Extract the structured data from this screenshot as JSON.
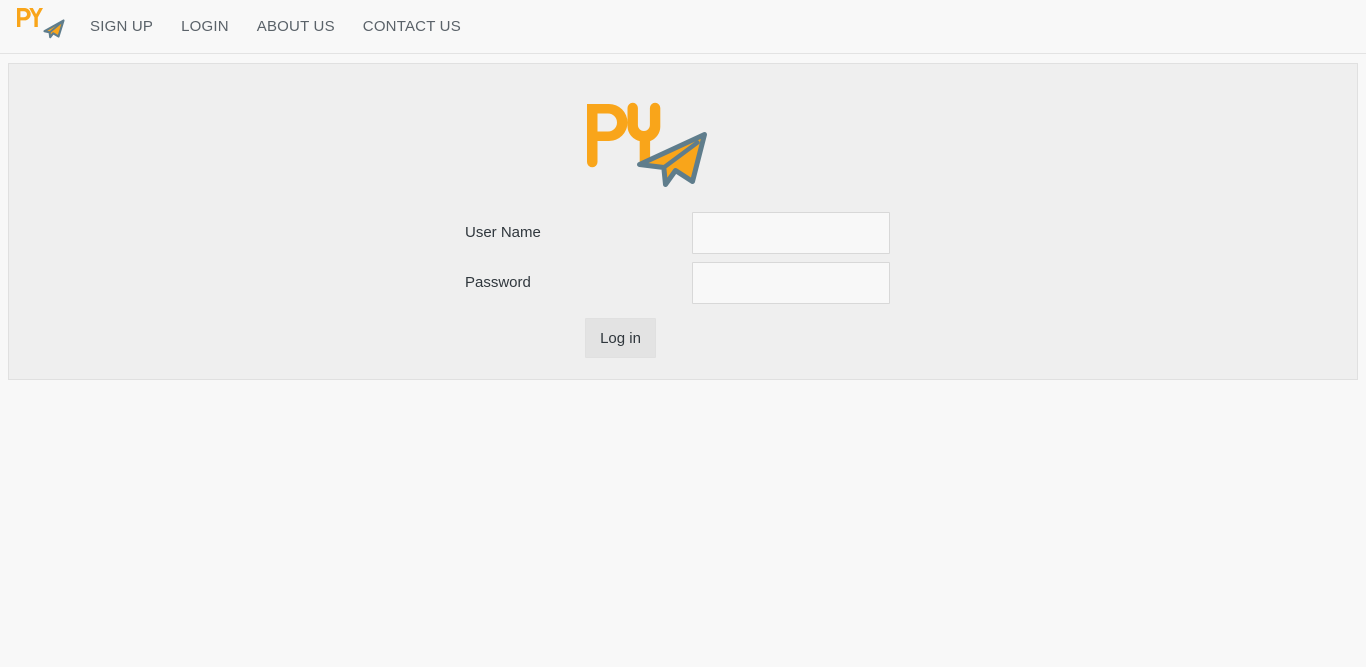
{
  "brand": {
    "text": "PY",
    "icon_name": "paper-plane-icon",
    "orange": "#f9a51a",
    "plane_outline": "#5f7d8c"
  },
  "navbar": {
    "links": [
      {
        "label": "SIGN UP",
        "name": "nav-link-sign-up"
      },
      {
        "label": "LOGIN",
        "name": "nav-link-login"
      },
      {
        "label": "ABOUT US",
        "name": "nav-link-about-us"
      },
      {
        "label": "CONTACT US",
        "name": "nav-link-contact-us"
      }
    ]
  },
  "login_form": {
    "username": {
      "label": "User Name",
      "value": "",
      "placeholder": ""
    },
    "password": {
      "label": "Password",
      "value": "",
      "placeholder": ""
    },
    "submit_label": "Log in"
  }
}
